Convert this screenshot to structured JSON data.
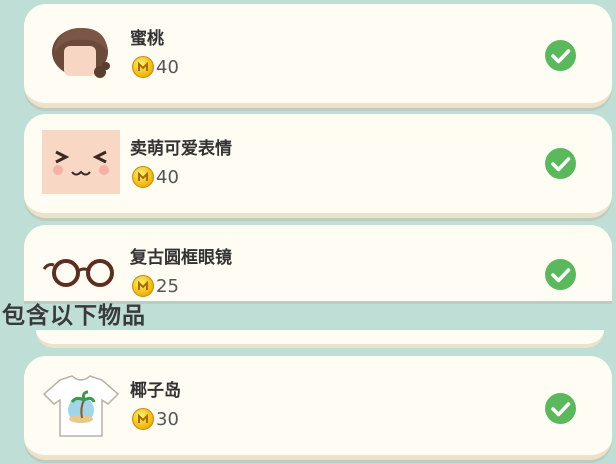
{
  "section_label": "包含以下物品",
  "currency_icon": "coin-icon",
  "accent_check_color": "#5cb85c",
  "items": [
    {
      "name": "蜜桃",
      "price": "40",
      "icon": "hairstyle-icon",
      "owned": true
    },
    {
      "name": "卖萌可爱表情",
      "price": "40",
      "icon": "cute-face-icon",
      "owned": true
    },
    {
      "name": "复古圆框眼镜",
      "price": "25",
      "icon": "round-glasses-icon",
      "owned": true
    },
    {
      "name": "椰子岛",
      "price": "30",
      "icon": "tshirt-icon",
      "owned": true
    }
  ]
}
